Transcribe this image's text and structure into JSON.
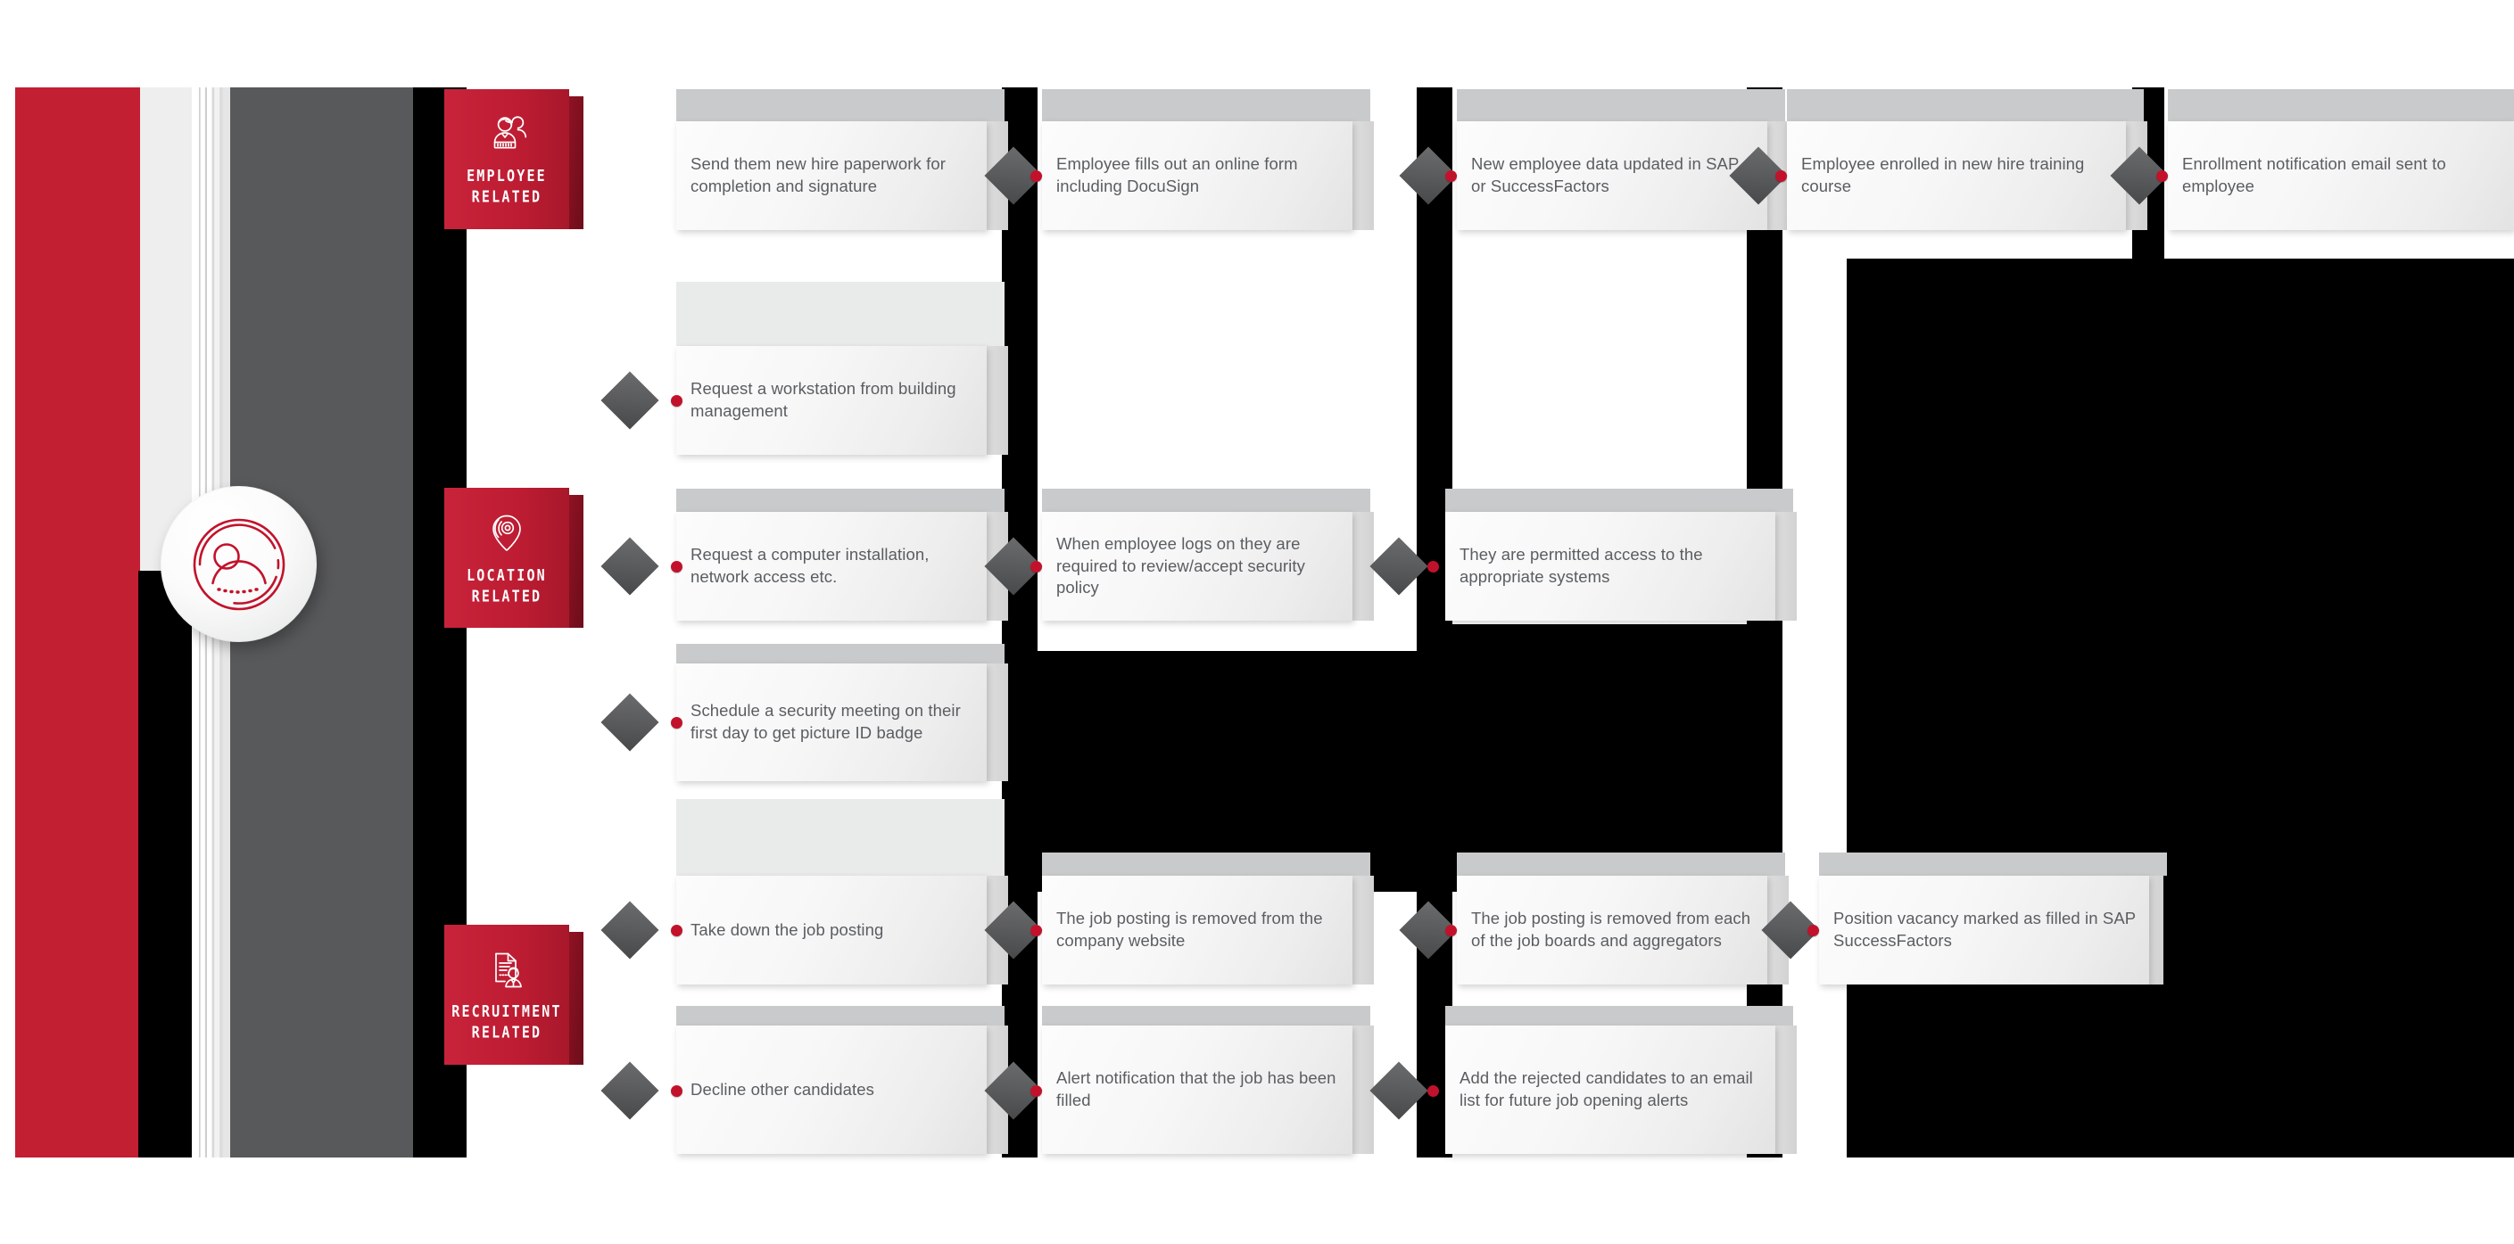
{
  "theme": {
    "brand_red": "#c21f33",
    "dot_red": "#c2122b",
    "grey_band": "#58595b",
    "card_text": "#5a5d61",
    "diamond_grey": "#5a5b5d"
  },
  "avatar": {
    "icon": "user-circle-icon"
  },
  "categories": [
    {
      "id": "employee",
      "label_line1": "EMPLOYEE",
      "label_line2": "RELATED",
      "icon": "employee-group-icon"
    },
    {
      "id": "location",
      "label_line1": "LOCATION",
      "label_line2": "RELATED",
      "icon": "location-pin-icon"
    },
    {
      "id": "recruitment",
      "label_line1": "RECRUITMENT",
      "label_line2": "RELATED",
      "icon": "resume-candidate-icon"
    }
  ],
  "rows": [
    {
      "id": "row-1",
      "category": "employee",
      "steps": [
        "Send them new hire paperwork for completion and signature",
        "Employee fills out an online form including DocuSign",
        "New employee data updated in SAP or SuccessFactors",
        "Employee enrolled in new hire training course",
        "Enrollment notification email sent to employee"
      ]
    },
    {
      "id": "row-2",
      "category": "location",
      "steps": [
        "Request a workstation from building management"
      ]
    },
    {
      "id": "row-3",
      "category": "location",
      "steps": [
        "Request a computer installation, network access etc.",
        "When employee logs on they are required to review/accept security policy",
        "They are permitted access to the appropriate systems"
      ]
    },
    {
      "id": "row-4",
      "category": "location",
      "steps": [
        "Schedule a security meeting on their first day to get picture ID badge"
      ]
    },
    {
      "id": "row-5",
      "category": "recruitment",
      "steps": [
        "Take down the job posting",
        "The job posting is removed from the company website",
        "The job posting is removed from each of the job boards and aggregators",
        "Position vacancy marked as filled in SAP SuccessFactors"
      ]
    },
    {
      "id": "row-6",
      "category": "recruitment",
      "steps": [
        "Decline other candidates",
        "Alert notification that the job has been filled",
        "Add the rejected candidates to an email list for future job opening alerts"
      ]
    }
  ]
}
